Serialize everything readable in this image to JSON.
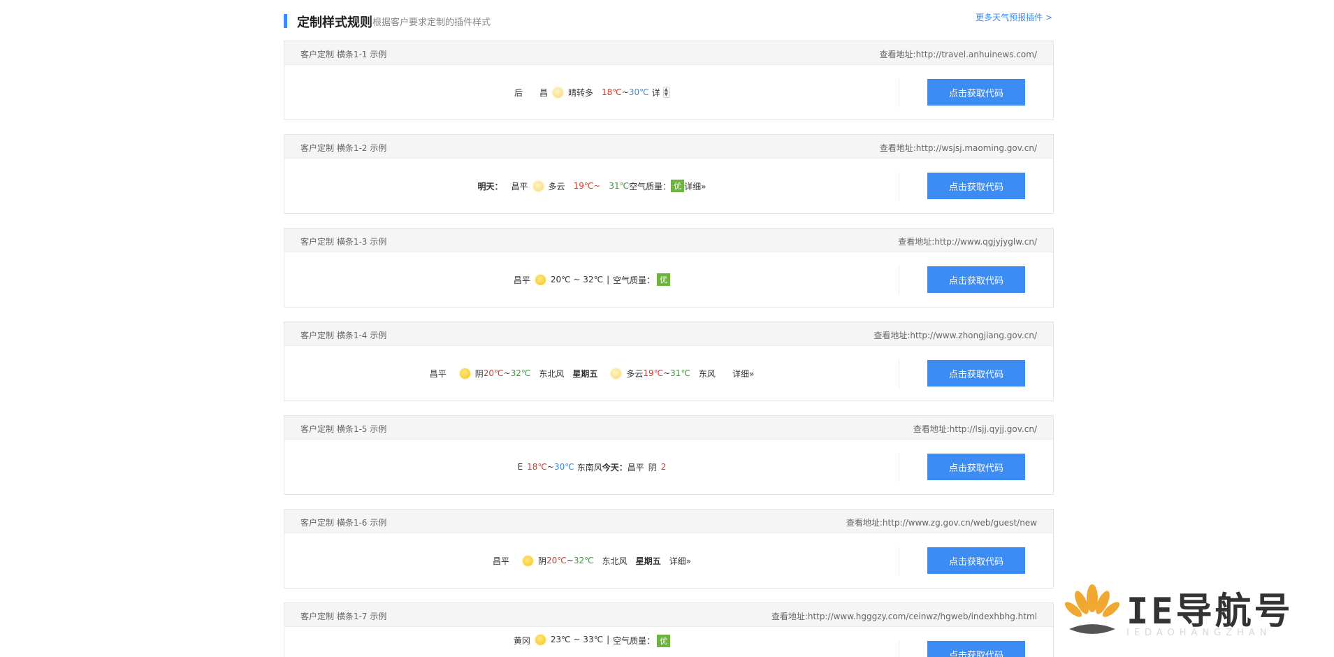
{
  "header": {
    "title": "定制样式规则",
    "subtitle": "根据客户要求定制的插件样式",
    "more_link": "更多天气预报插件 >"
  },
  "button_label": "点击获取代码",
  "url_prefix": "查看地址:",
  "cards": [
    {
      "label": "客户定制 横条1-1 示例",
      "url": "http://travel.anhuinews.com/",
      "w": {
        "a": "后",
        "b": "昌",
        "cond": "晴转多",
        "t_hi": "18℃",
        "sep": "~",
        "t_lo": "30℃",
        "more": "详"
      }
    },
    {
      "label": "客户定制 横条1-2 示例",
      "url": "http://wsjsj.maoming.gov.cn/",
      "w": {
        "day": "明天：",
        "city": "昌平",
        "cond": "多云",
        "t_hi": "19℃~",
        "t_lo": "31℃",
        "aq_label": "空气质量：",
        "aq": "优",
        "more": "详细»"
      }
    },
    {
      "label": "客户定制 横条1-3 示例",
      "url": "http://www.qgjyjyglw.cn/",
      "w": {
        "city": "昌平",
        "temp": "20℃ ~ 32℃",
        "pipe": "|",
        "aq_label": "空气质量：",
        "aq": "优"
      }
    },
    {
      "label": "客户定制 横条1-4 示例",
      "url": "http://www.zhongjiang.gov.cn/",
      "w": {
        "city": "昌平",
        "cond": "阴",
        "t1": "20℃",
        "sep": "~",
        "t2": "32℃",
        "wind": "东北风",
        "day": "星期五",
        "cond2": "多云",
        "t3": "19℃",
        "sep2": "~",
        "t4": "31℃",
        "wind2": "东风",
        "more": "详细»"
      }
    },
    {
      "label": "客户定制 横条1-5 示例",
      "url": "http://lsjj.qyjj.gov.cn/",
      "w": {
        "pre": "E",
        "t1": "18℃",
        "sep": "~",
        "t2": "30℃",
        "wind": "东南风",
        "day": "今天：",
        "city": "昌平",
        "cond": "阴",
        "t3": "2"
      }
    },
    {
      "label": "客户定制 横条1-6 示例",
      "url": "http://www.zg.gov.cn/web/guest/new",
      "w": {
        "city": "昌平",
        "cond": "阴",
        "t1": "20℃",
        "sep": "~",
        "t2": "32℃",
        "wind": "东北风",
        "day": "星期五",
        "more": "详细»"
      }
    },
    {
      "label": "客户定制 横条1-7 示例",
      "url": "http://www.hgggzy.com/ceinwz/hgweb/indexhbhg.html",
      "w": {
        "city": "黄冈",
        "temp": "23℃ ~ 33℃",
        "pipe": "|",
        "aq_label": "空气质量：",
        "aq": "优"
      }
    }
  ],
  "watermark": {
    "title": "IE导航号",
    "sub": "IEDAOHANGZHAN"
  }
}
